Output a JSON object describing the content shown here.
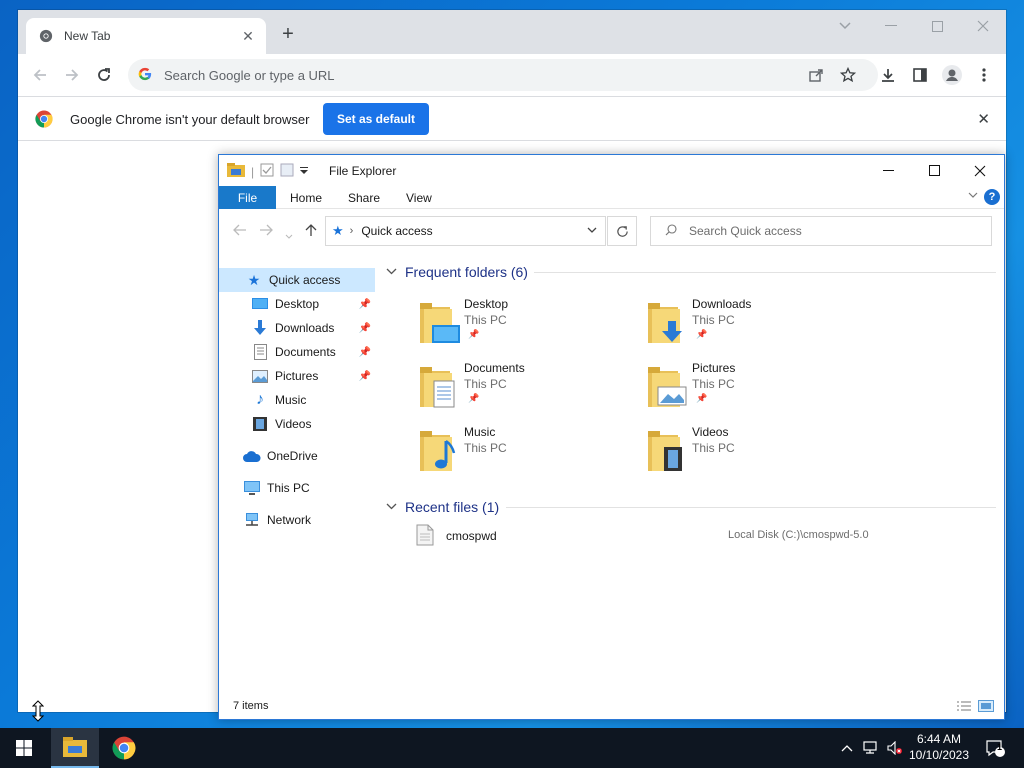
{
  "chrome": {
    "tab_title": "New Tab",
    "omnibox_placeholder": "Search Google or type a URL",
    "infobar_text": "Google Chrome isn't your default browser",
    "set_default_label": "Set as default"
  },
  "explorer": {
    "title": "File Explorer",
    "ribbon_tabs": [
      "File",
      "Home",
      "Share",
      "View"
    ],
    "address": "Quick access",
    "search_placeholder": "Search Quick access",
    "nav": {
      "quick_access": "Quick access",
      "items": [
        "Desktop",
        "Downloads",
        "Documents",
        "Pictures",
        "Music",
        "Videos"
      ],
      "onedrive": "OneDrive",
      "this_pc": "This PC",
      "network": "Network"
    },
    "frequent_header": "Frequent folders (6)",
    "folders": [
      {
        "name": "Desktop",
        "location": "This PC"
      },
      {
        "name": "Downloads",
        "location": "This PC"
      },
      {
        "name": "Documents",
        "location": "This PC"
      },
      {
        "name": "Pictures",
        "location": "This PC"
      },
      {
        "name": "Music",
        "location": "This PC"
      },
      {
        "name": "Videos",
        "location": "This PC"
      }
    ],
    "recent_header": "Recent files (1)",
    "recent_files": [
      {
        "name": "cmospwd",
        "path": "Local Disk (C:)\\cmospwd-5.0"
      }
    ],
    "status_count": "7 items"
  },
  "taskbar": {
    "time": "6:44 AM",
    "date": "10/10/2023",
    "notification_count": "1"
  },
  "colors": {
    "accent": "#1a73e8",
    "ribbon_file": "#1979ca",
    "selection": "#cce8ff",
    "taskbar": "#0e1621"
  }
}
